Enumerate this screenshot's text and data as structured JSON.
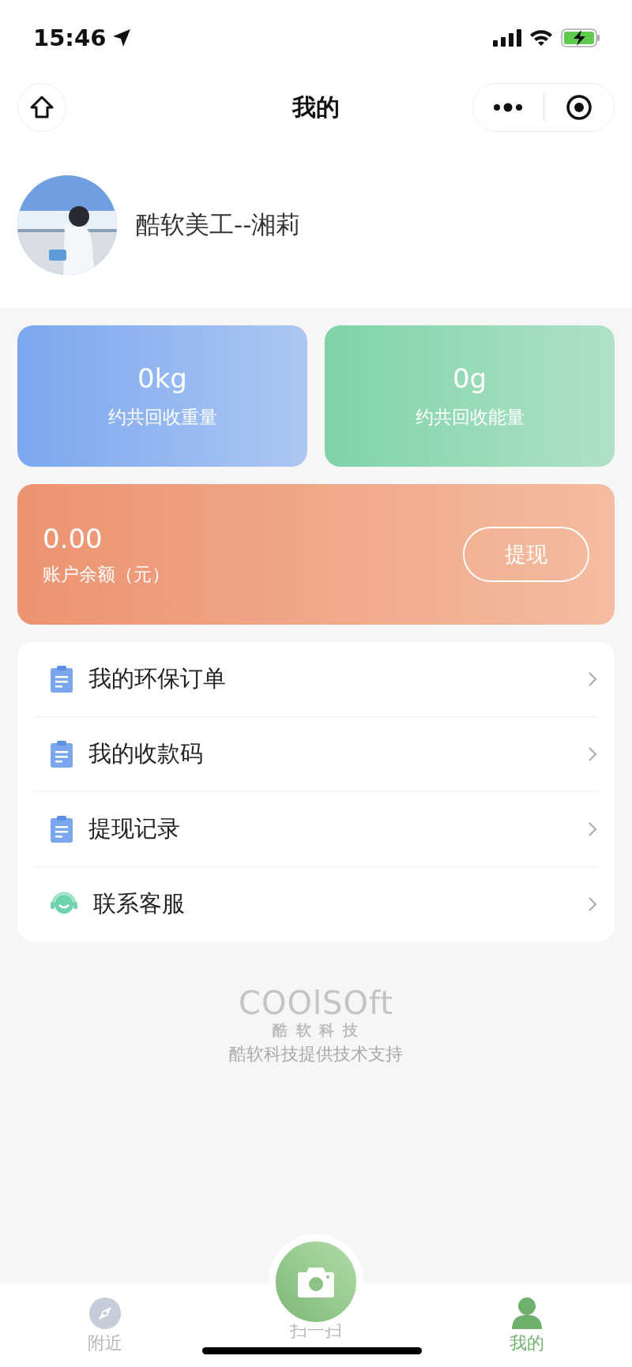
{
  "status_bar": {
    "time": "15:46"
  },
  "nav": {
    "title": "我的"
  },
  "profile": {
    "name": "酷软美工--湘莉"
  },
  "stats": [
    {
      "value": "0kg",
      "label": "约共回收重量",
      "color": "#7ba7ef"
    },
    {
      "value": "0g",
      "label": "约共回收能量",
      "color": "#7fd3a8"
    }
  ],
  "balance": {
    "amount": "0.00",
    "label": "账户余额（元）",
    "button": "提现"
  },
  "menu": [
    {
      "kind": "document",
      "label": "我的环保订单"
    },
    {
      "kind": "document",
      "label": "我的收款码"
    },
    {
      "kind": "document",
      "label": "提现记录"
    },
    {
      "kind": "support",
      "label": "联系客服"
    }
  ],
  "footer": {
    "logo": "COOlSOft",
    "logo_cn": "酷 软 科 技",
    "credit": "酷软科技提供技术支持"
  },
  "tabbar": [
    {
      "kind": "compass",
      "label": "附近",
      "selected": false
    },
    {
      "kind": "camera",
      "label": "扫一扫",
      "selected": false
    },
    {
      "kind": "person",
      "label": "我的",
      "selected": true
    }
  ]
}
